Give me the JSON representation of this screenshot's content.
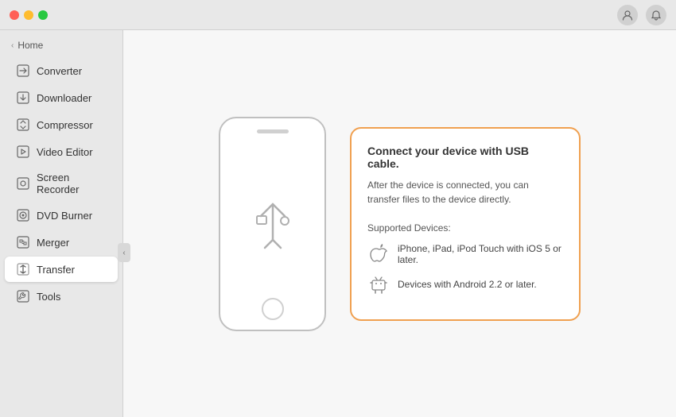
{
  "titlebar": {
    "user_icon": "👤",
    "bell_icon": "🔔"
  },
  "sidebar": {
    "home_label": "Home",
    "items": [
      {
        "id": "converter",
        "label": "Converter",
        "icon": "⊞"
      },
      {
        "id": "downloader",
        "label": "Downloader",
        "icon": "⊞"
      },
      {
        "id": "compressor",
        "label": "Compressor",
        "icon": "⊞"
      },
      {
        "id": "video-editor",
        "label": "Video Editor",
        "icon": "⊞"
      },
      {
        "id": "screen-recorder",
        "label": "Screen Recorder",
        "icon": "⊞"
      },
      {
        "id": "dvd-burner",
        "label": "DVD Burner",
        "icon": "⊞"
      },
      {
        "id": "merger",
        "label": "Merger",
        "icon": "⊞"
      },
      {
        "id": "transfer",
        "label": "Transfer",
        "icon": "⊞",
        "active": true
      },
      {
        "id": "tools",
        "label": "Tools",
        "icon": "⊞"
      }
    ]
  },
  "content": {
    "card": {
      "title": "Connect your device with USB cable.",
      "description": "After the device is connected, you can transfer files to the device directly.",
      "supported_label": "Supported Devices:",
      "devices": [
        {
          "id": "apple",
          "text": "iPhone, iPad, iPod Touch with iOS 5 or later."
        },
        {
          "id": "android",
          "text": "Devices with Android 2.2 or later."
        }
      ]
    }
  }
}
